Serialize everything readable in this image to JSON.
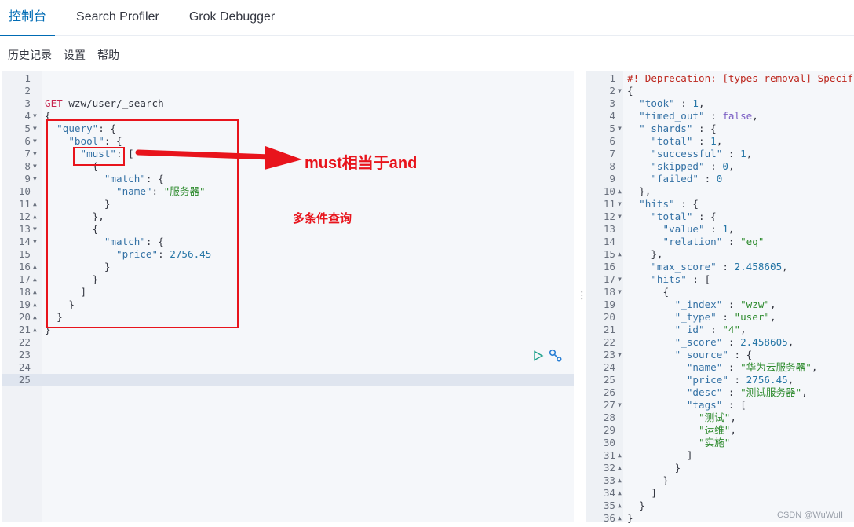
{
  "tabs": [
    {
      "label": "控制台",
      "active": true
    },
    {
      "label": "Search Profiler"
    },
    {
      "label": "Grok Debugger"
    }
  ],
  "menu": {
    "history": "历史记录",
    "settings": "设置",
    "help": "帮助"
  },
  "request_editor": {
    "active_line": 25,
    "lines": [
      {
        "t": []
      },
      {
        "t": []
      },
      {
        "t": [
          [
            "m",
            "GET"
          ],
          [
            "u",
            " wzw/user/_search"
          ]
        ]
      },
      {
        "f": "d",
        "t": [
          [
            "p",
            "{"
          ]
        ]
      },
      {
        "f": "d",
        "t": [
          [
            "p",
            "  "
          ],
          [
            "k",
            "\"query\""
          ],
          [
            "p",
            ": {"
          ]
        ]
      },
      {
        "f": "d",
        "t": [
          [
            "p",
            "    "
          ],
          [
            "k",
            "\"bool\""
          ],
          [
            "p",
            ": {"
          ]
        ]
      },
      {
        "f": "d",
        "t": [
          [
            "p",
            "      "
          ],
          [
            "k",
            "\"must\""
          ],
          [
            "p",
            ": ["
          ]
        ]
      },
      {
        "f": "d",
        "t": [
          [
            "p",
            "        {"
          ]
        ]
      },
      {
        "f": "d",
        "t": [
          [
            "p",
            "          "
          ],
          [
            "k",
            "\"match\""
          ],
          [
            "p",
            ": {"
          ]
        ]
      },
      {
        "t": [
          [
            "p",
            "            "
          ],
          [
            "k",
            "\"name\""
          ],
          [
            "p",
            ": "
          ],
          [
            "s",
            "\"服务器\""
          ]
        ]
      },
      {
        "f": "u",
        "t": [
          [
            "p",
            "          }"
          ]
        ]
      },
      {
        "f": "u",
        "t": [
          [
            "p",
            "        },"
          ]
        ]
      },
      {
        "f": "d",
        "t": [
          [
            "p",
            "        {"
          ]
        ]
      },
      {
        "f": "d",
        "t": [
          [
            "p",
            "          "
          ],
          [
            "k",
            "\"match\""
          ],
          [
            "p",
            ": {"
          ]
        ]
      },
      {
        "t": [
          [
            "p",
            "            "
          ],
          [
            "k",
            "\"price\""
          ],
          [
            "p",
            ": "
          ],
          [
            "n",
            "2756.45"
          ]
        ]
      },
      {
        "f": "u",
        "t": [
          [
            "p",
            "          }"
          ]
        ]
      },
      {
        "f": "u",
        "t": [
          [
            "p",
            "        }"
          ]
        ]
      },
      {
        "f": "u",
        "t": [
          [
            "p",
            "      ]"
          ]
        ]
      },
      {
        "f": "u",
        "t": [
          [
            "p",
            "    }"
          ]
        ]
      },
      {
        "f": "u",
        "t": [
          [
            "p",
            "  }"
          ]
        ]
      },
      {
        "f": "u",
        "t": [
          [
            "p",
            "}"
          ]
        ]
      },
      {
        "t": []
      },
      {
        "t": []
      },
      {
        "t": []
      },
      {
        "t": []
      }
    ]
  },
  "response_editor": {
    "lines": [
      {
        "t": [
          [
            "c",
            "#! Deprecation: [types removal] Specif"
          ]
        ]
      },
      {
        "f": "d",
        "t": [
          [
            "p",
            "{"
          ]
        ]
      },
      {
        "t": [
          [
            "p",
            "  "
          ],
          [
            "k",
            "\"took\""
          ],
          [
            "p",
            " : "
          ],
          [
            "n",
            "1"
          ],
          [
            "p",
            ","
          ]
        ]
      },
      {
        "t": [
          [
            "p",
            "  "
          ],
          [
            "k",
            "\"timed_out\""
          ],
          [
            "p",
            " : "
          ],
          [
            "b",
            "false"
          ],
          [
            "p",
            ","
          ]
        ]
      },
      {
        "f": "d",
        "t": [
          [
            "p",
            "  "
          ],
          [
            "k",
            "\"_shards\""
          ],
          [
            "p",
            " : {"
          ]
        ]
      },
      {
        "t": [
          [
            "p",
            "    "
          ],
          [
            "k",
            "\"total\""
          ],
          [
            "p",
            " : "
          ],
          [
            "n",
            "1"
          ],
          [
            "p",
            ","
          ]
        ]
      },
      {
        "t": [
          [
            "p",
            "    "
          ],
          [
            "k",
            "\"successful\""
          ],
          [
            "p",
            " : "
          ],
          [
            "n",
            "1"
          ],
          [
            "p",
            ","
          ]
        ]
      },
      {
        "t": [
          [
            "p",
            "    "
          ],
          [
            "k",
            "\"skipped\""
          ],
          [
            "p",
            " : "
          ],
          [
            "n",
            "0"
          ],
          [
            "p",
            ","
          ]
        ]
      },
      {
        "t": [
          [
            "p",
            "    "
          ],
          [
            "k",
            "\"failed\""
          ],
          [
            "p",
            " : "
          ],
          [
            "n",
            "0"
          ]
        ]
      },
      {
        "f": "u",
        "t": [
          [
            "p",
            "  },"
          ]
        ]
      },
      {
        "f": "d",
        "t": [
          [
            "p",
            "  "
          ],
          [
            "k",
            "\"hits\""
          ],
          [
            "p",
            " : {"
          ]
        ]
      },
      {
        "f": "d",
        "t": [
          [
            "p",
            "    "
          ],
          [
            "k",
            "\"total\""
          ],
          [
            "p",
            " : {"
          ]
        ]
      },
      {
        "t": [
          [
            "p",
            "      "
          ],
          [
            "k",
            "\"value\""
          ],
          [
            "p",
            " : "
          ],
          [
            "n",
            "1"
          ],
          [
            "p",
            ","
          ]
        ]
      },
      {
        "t": [
          [
            "p",
            "      "
          ],
          [
            "k",
            "\"relation\""
          ],
          [
            "p",
            " : "
          ],
          [
            "s",
            "\"eq\""
          ]
        ]
      },
      {
        "f": "u",
        "t": [
          [
            "p",
            "    },"
          ]
        ]
      },
      {
        "t": [
          [
            "p",
            "    "
          ],
          [
            "k",
            "\"max_score\""
          ],
          [
            "p",
            " : "
          ],
          [
            "n",
            "2.458605"
          ],
          [
            "p",
            ","
          ]
        ]
      },
      {
        "f": "d",
        "t": [
          [
            "p",
            "    "
          ],
          [
            "k",
            "\"hits\""
          ],
          [
            "p",
            " : ["
          ]
        ]
      },
      {
        "f": "d",
        "t": [
          [
            "p",
            "      {"
          ]
        ]
      },
      {
        "t": [
          [
            "p",
            "        "
          ],
          [
            "k",
            "\"_index\""
          ],
          [
            "p",
            " : "
          ],
          [
            "s",
            "\"wzw\""
          ],
          [
            "p",
            ","
          ]
        ]
      },
      {
        "t": [
          [
            "p",
            "        "
          ],
          [
            "k",
            "\"_type\""
          ],
          [
            "p",
            " : "
          ],
          [
            "s",
            "\"user\""
          ],
          [
            "p",
            ","
          ]
        ]
      },
      {
        "t": [
          [
            "p",
            "        "
          ],
          [
            "k",
            "\"_id\""
          ],
          [
            "p",
            " : "
          ],
          [
            "s",
            "\"4\""
          ],
          [
            "p",
            ","
          ]
        ]
      },
      {
        "t": [
          [
            "p",
            "        "
          ],
          [
            "k",
            "\"_score\""
          ],
          [
            "p",
            " : "
          ],
          [
            "n",
            "2.458605"
          ],
          [
            "p",
            ","
          ]
        ]
      },
      {
        "f": "d",
        "t": [
          [
            "p",
            "        "
          ],
          [
            "k",
            "\"_source\""
          ],
          [
            "p",
            " : {"
          ]
        ]
      },
      {
        "t": [
          [
            "p",
            "          "
          ],
          [
            "k",
            "\"name\""
          ],
          [
            "p",
            " : "
          ],
          [
            "s",
            "\"华为云服务器\""
          ],
          [
            "p",
            ","
          ]
        ]
      },
      {
        "t": [
          [
            "p",
            "          "
          ],
          [
            "k",
            "\"price\""
          ],
          [
            "p",
            " : "
          ],
          [
            "n",
            "2756.45"
          ],
          [
            "p",
            ","
          ]
        ]
      },
      {
        "t": [
          [
            "p",
            "          "
          ],
          [
            "k",
            "\"desc\""
          ],
          [
            "p",
            " : "
          ],
          [
            "s",
            "\"测试服务器\""
          ],
          [
            "p",
            ","
          ]
        ]
      },
      {
        "f": "d",
        "t": [
          [
            "p",
            "          "
          ],
          [
            "k",
            "\"tags\""
          ],
          [
            "p",
            " : ["
          ]
        ]
      },
      {
        "t": [
          [
            "p",
            "            "
          ],
          [
            "s",
            "\"测试\""
          ],
          [
            "p",
            ","
          ]
        ]
      },
      {
        "t": [
          [
            "p",
            "            "
          ],
          [
            "s",
            "\"运维\""
          ],
          [
            "p",
            ","
          ]
        ]
      },
      {
        "t": [
          [
            "p",
            "            "
          ],
          [
            "s",
            "\"实施\""
          ]
        ]
      },
      {
        "f": "u",
        "t": [
          [
            "p",
            "          ]"
          ]
        ]
      },
      {
        "f": "u",
        "t": [
          [
            "p",
            "        }"
          ]
        ]
      },
      {
        "f": "u",
        "t": [
          [
            "p",
            "      }"
          ]
        ]
      },
      {
        "f": "u",
        "t": [
          [
            "p",
            "    ]"
          ]
        ]
      },
      {
        "f": "u",
        "t": [
          [
            "p",
            "  }"
          ]
        ]
      },
      {
        "f": "u",
        "t": [
          [
            "p",
            "}"
          ]
        ]
      }
    ]
  },
  "annotations": {
    "arrow_label": "must相当于and",
    "note": "多条件查询"
  },
  "watermark": "CSDN @WuWuII",
  "colors": {
    "accent": "#006bb4",
    "annotation": "#e8141c",
    "run": "#1ba08a",
    "wrench": "#2a7fd4"
  }
}
